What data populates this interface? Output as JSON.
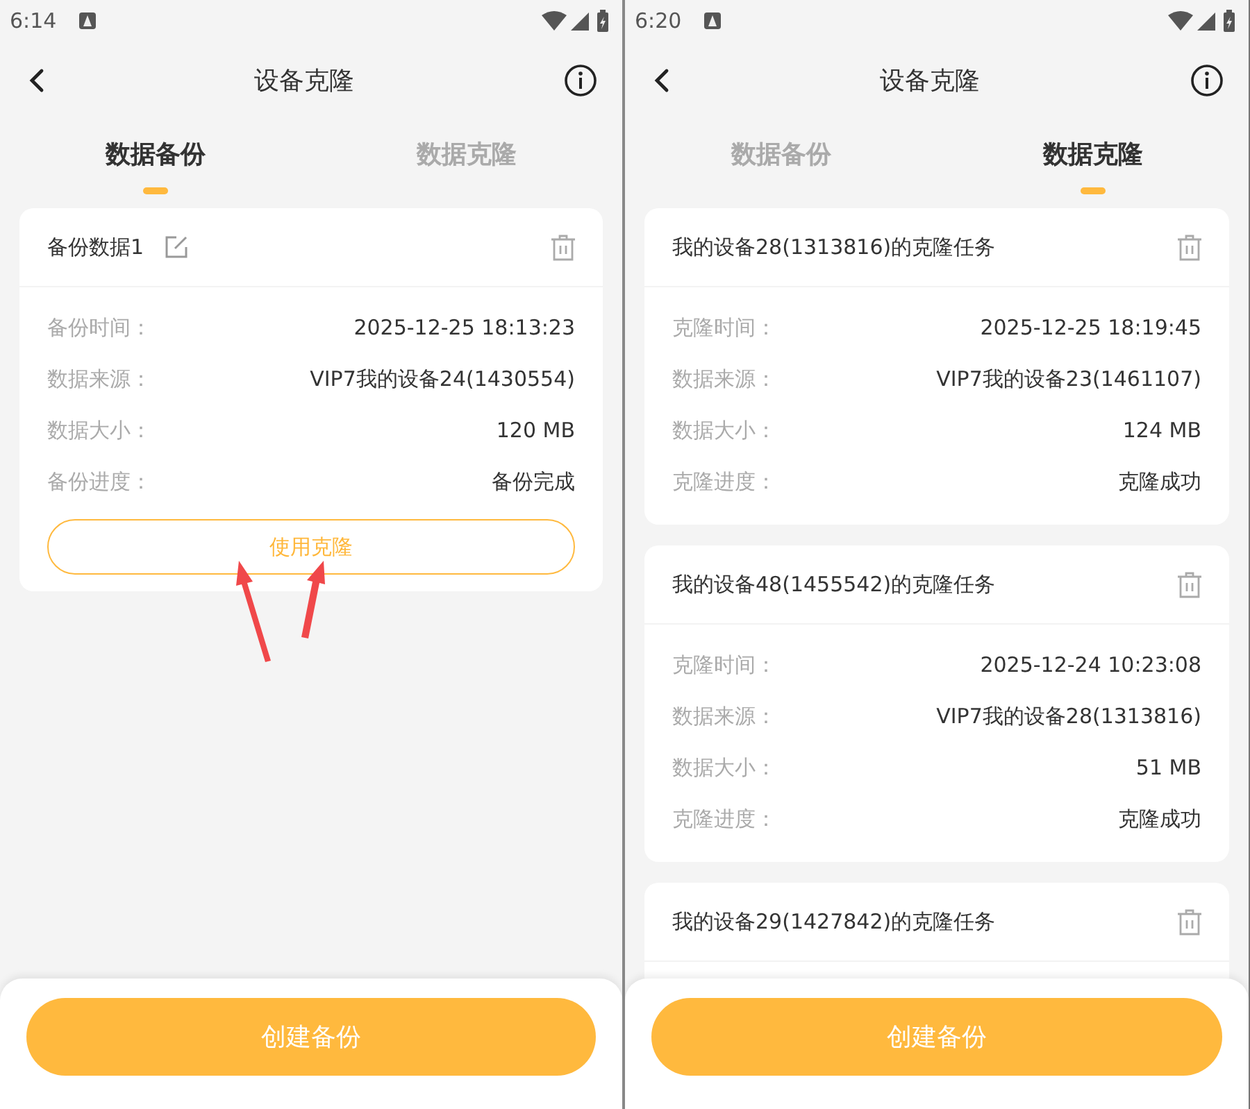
{
  "screens": [
    {
      "status_bar": {
        "time": "6:14"
      },
      "header": {
        "title": "设备克隆"
      },
      "tabs": [
        {
          "label": "数据备份",
          "selected": true
        },
        {
          "label": "数据克隆",
          "selected": false
        }
      ],
      "cards": [
        {
          "title": "备份数据1",
          "editable": true,
          "rows": [
            {
              "label": "备份时间：",
              "value": "2025-12-25 18:13:23"
            },
            {
              "label": "数据来源：",
              "value": "VIP7我的设备24(1430554)"
            },
            {
              "label": "数据大小：",
              "value": "120 MB"
            },
            {
              "label": "备份进度：",
              "value": "备份完成"
            }
          ],
          "action": "使用克隆"
        }
      ],
      "annotation_arrows": true,
      "bottom_button": "创建备份"
    },
    {
      "status_bar": {
        "time": "6:20"
      },
      "header": {
        "title": "设备克隆"
      },
      "tabs": [
        {
          "label": "数据备份",
          "selected": false
        },
        {
          "label": "数据克隆",
          "selected": true
        }
      ],
      "cards": [
        {
          "title": "我的设备28(1313816)的克隆任务",
          "editable": false,
          "rows": [
            {
              "label": "克隆时间：",
              "value": "2025-12-25 18:19:45"
            },
            {
              "label": "数据来源：",
              "value": "VIP7我的设备23(1461107)"
            },
            {
              "label": "数据大小：",
              "value": "124 MB"
            },
            {
              "label": "克隆进度：",
              "value": "克隆成功"
            }
          ]
        },
        {
          "title": "我的设备48(1455542)的克隆任务",
          "editable": false,
          "rows": [
            {
              "label": "克隆时间：",
              "value": "2025-12-24 10:23:08"
            },
            {
              "label": "数据来源：",
              "value": "VIP7我的设备28(1313816)"
            },
            {
              "label": "数据大小：",
              "value": "51 MB"
            },
            {
              "label": "克隆进度：",
              "value": "克隆成功"
            }
          ]
        },
        {
          "title": "我的设备29(1427842)的克隆任务",
          "editable": false
        }
      ],
      "annotation_arrows": false,
      "bottom_button": "创建备份"
    }
  ]
}
